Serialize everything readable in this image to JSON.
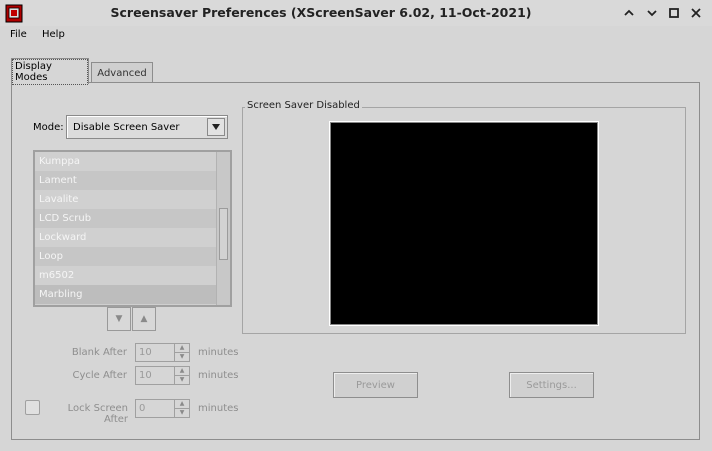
{
  "window": {
    "title": "Screensaver Preferences  (XScreenSaver 6.02, 11-Oct-2021)",
    "icon": "xscreensaver-icon",
    "controls": [
      "collapse-icon",
      "minimize-icon",
      "maximize-icon",
      "close-icon"
    ]
  },
  "menubar": {
    "file": "File",
    "help": "Help"
  },
  "tabs": {
    "display_modes": "Display Modes",
    "advanced": "Advanced"
  },
  "mode": {
    "label": "Mode:",
    "value": "Disable Screen Saver"
  },
  "savers": [
    "Kumppa",
    "Lament",
    "Lavalite",
    "LCD Scrub",
    "Lockward",
    "Loop",
    "m6502",
    "Marbling"
  ],
  "selected_saver": "Marbling",
  "blank_after": {
    "label": "Blank After",
    "value": "10",
    "unit": "minutes"
  },
  "cycle_after": {
    "label": "Cycle After",
    "value": "10",
    "unit": "minutes"
  },
  "lock_screen": {
    "label": "Lock Screen After",
    "value": "0",
    "unit": "minutes",
    "checked": false
  },
  "preview_frame": {
    "label": "Screen Saver Disabled"
  },
  "buttons": {
    "preview": "Preview",
    "settings": "Settings..."
  },
  "colors": {
    "background": "#d6d6d6",
    "preview_bg": "#000000",
    "disabled_text": "#9a9a9a"
  }
}
